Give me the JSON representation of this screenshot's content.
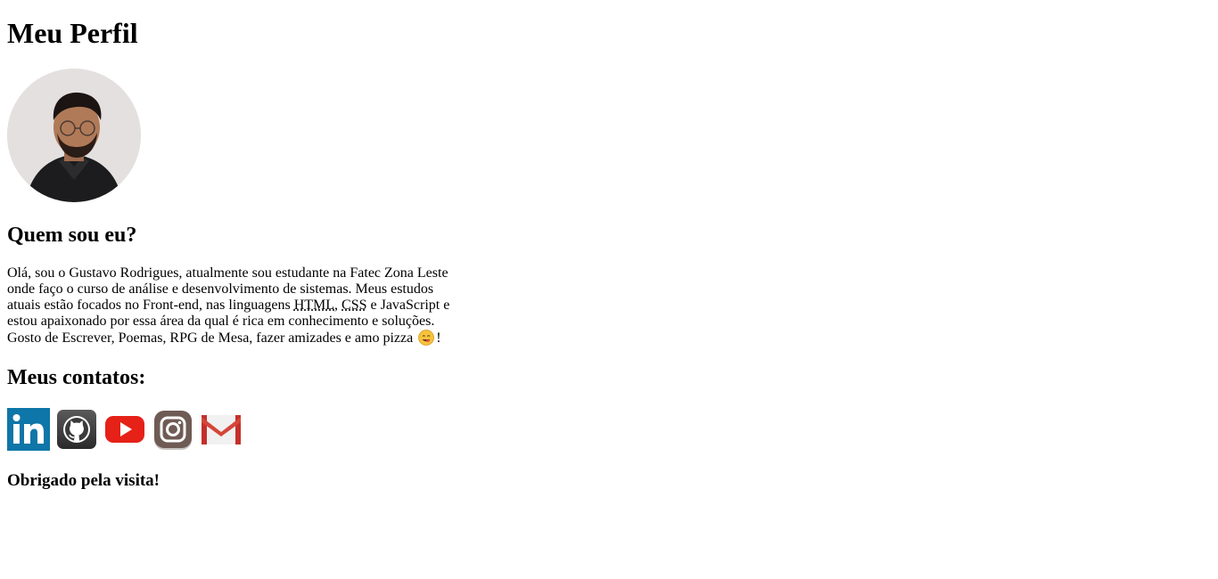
{
  "page": {
    "title": "Meu Perfil",
    "avatar_alt": "Gustavo Rodrigues"
  },
  "about": {
    "heading": "Quem sou eu?",
    "text_1": "Olá, sou o Gustavo Rodrigues, atualmente sou estudante na Fatec Zona Leste onde faço o curso de análise e desenvolvimento de sistemas. Meus estudos atuais estão focados no Front-end, nas linguagens ",
    "abbr_html": "HTML",
    "sep_1": ", ",
    "abbr_css": "CSS",
    "text_2": " e JavaScript e estou apaixonado por essa área da qual é rica em conhecimento e soluções. Gosto de Escrever, Poemas, RPG de Mesa, fazer amizades e amo pizza ",
    "emoji_icon": "yum-face-emoji",
    "text_3": "!"
  },
  "contacts": {
    "heading": "Meus contatos:",
    "items": [
      {
        "name": "LinkedIn",
        "icon": "linkedin-icon",
        "color": "#0e76a8"
      },
      {
        "name": "GitHub",
        "icon": "github-icon",
        "color": "#3a3a3a"
      },
      {
        "name": "YouTube",
        "icon": "youtube-icon",
        "color": "#e62117"
      },
      {
        "name": "Instagram",
        "icon": "instagram-icon",
        "color": "#6f5b55"
      },
      {
        "name": "Gmail",
        "icon": "gmail-icon",
        "color": "#d44638"
      }
    ]
  },
  "footer": {
    "thanks": "Obrigado pela visita!"
  }
}
